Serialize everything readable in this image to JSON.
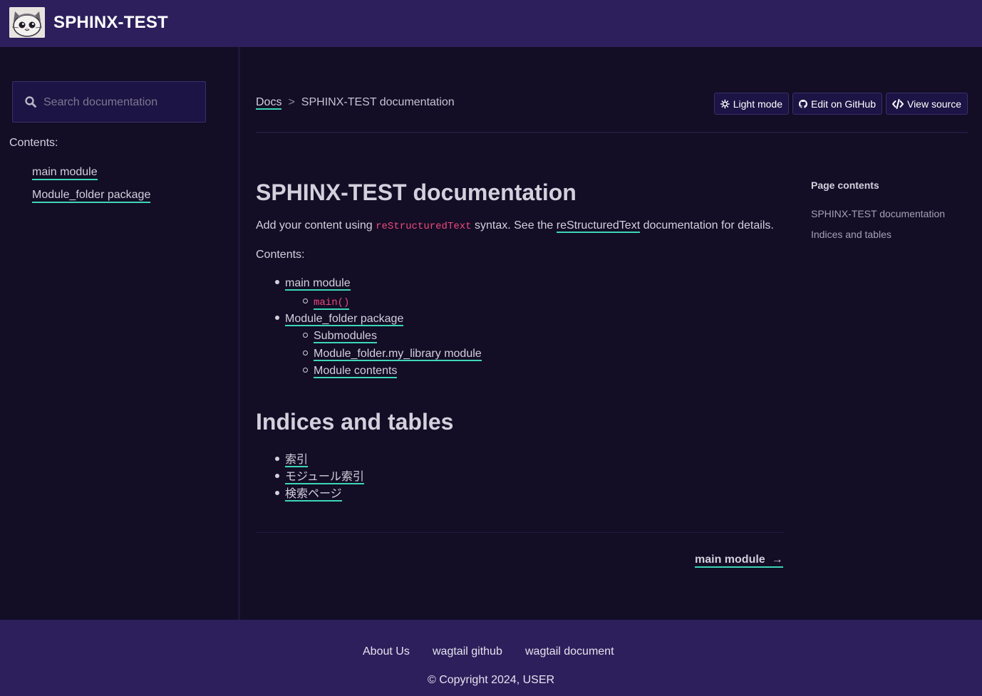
{
  "header": {
    "site_title": "SPHINX-TEST",
    "logo_icon": "cat-face-icon"
  },
  "sidebar": {
    "search_placeholder": "Search documentation",
    "contents_label": "Contents:",
    "items": [
      {
        "label": "main module"
      },
      {
        "label": "Module_folder package"
      }
    ]
  },
  "breadcrumb": {
    "root": "Docs",
    "separator": ">",
    "current": "SPHINX-TEST documentation"
  },
  "toolbar": {
    "light_mode": "Light mode",
    "edit_github": "Edit on GitHub",
    "view_source": "View source"
  },
  "article": {
    "title": "SPHINX-TEST documentation",
    "intro_prefix": "Add your content using",
    "intro_code": "reStructuredText",
    "intro_middle": "syntax. See the",
    "intro_link": "reStructuredText",
    "intro_suffix": "documentation for details.",
    "contents_label": "Contents:",
    "toc": [
      {
        "label": "main module",
        "children": [
          {
            "label": "main()",
            "code": true
          }
        ]
      },
      {
        "label": "Module_folder package",
        "children": [
          {
            "label": "Submodules"
          },
          {
            "label": "Module_folder.my_library module"
          },
          {
            "label": "Module contents"
          }
        ]
      }
    ],
    "indices_title": "Indices and tables",
    "indices": [
      {
        "label": "索引"
      },
      {
        "label": "モジュール索引"
      },
      {
        "label": "検索ページ"
      }
    ],
    "next_label": "main module",
    "next_arrow": "→"
  },
  "page_contents": {
    "title": "Page contents",
    "items": [
      {
        "label": "SPHINX-TEST documentation"
      },
      {
        "label": "Indices and tables"
      }
    ]
  },
  "footer": {
    "links": [
      {
        "label": "About Us"
      },
      {
        "label": "wagtail github"
      },
      {
        "label": "wagtail document"
      }
    ],
    "copyright": "© Copyright 2024, USER"
  },
  "colors": {
    "header_bg": "#2d1f5c",
    "page_bg": "#130d26",
    "link_underline": "#3dd6b6",
    "code": "#ef4a7b"
  }
}
